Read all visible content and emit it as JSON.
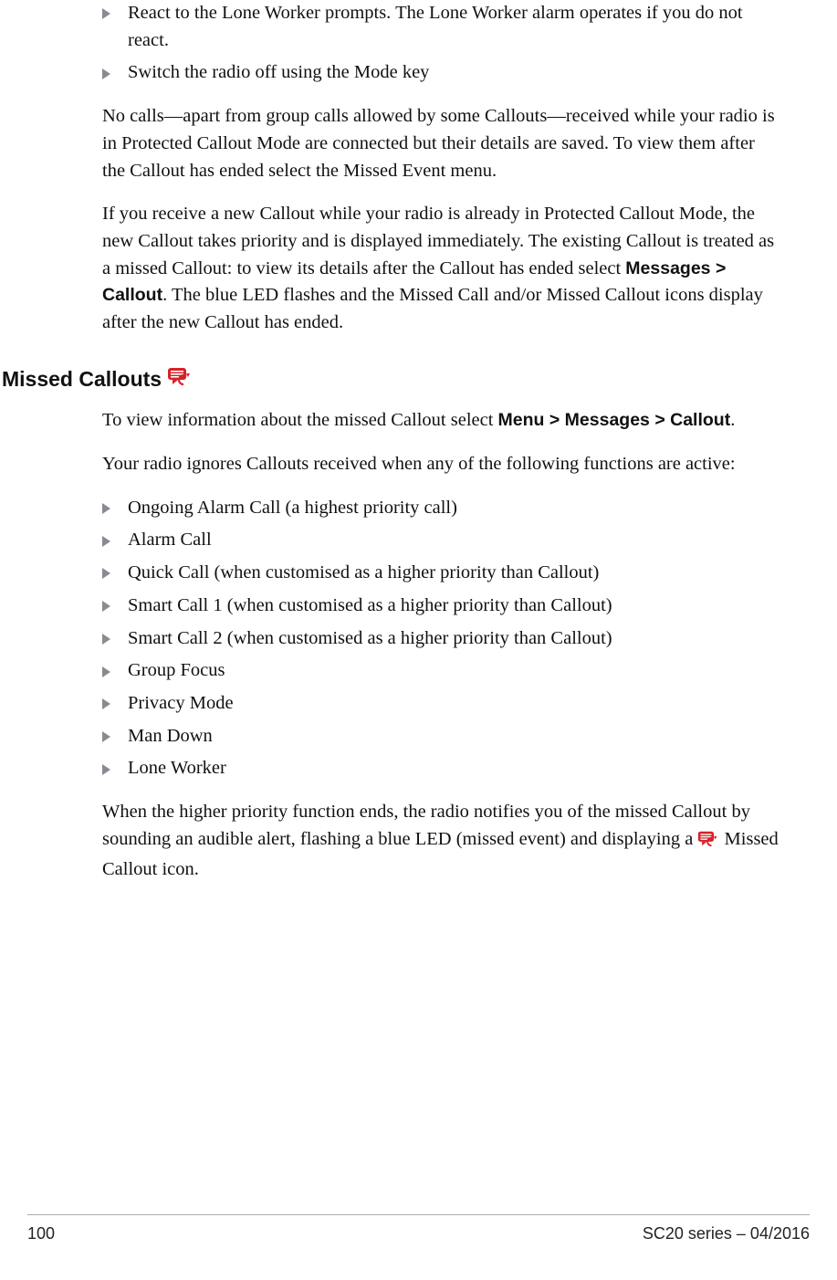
{
  "top_list": [
    "React to the Lone Worker prompts. The Lone Worker alarm operates if you do not react.",
    "Switch the radio off using the Mode key"
  ],
  "para1": "No calls—apart from group calls allowed by some Callouts—received while your radio is in Protected Callout Mode are connected but their details are saved. To view them after the Callout has ended select the Missed Event menu.",
  "para2_pre": "If you receive a new Callout while your radio is already in Protected Callout Mode, the new Callout takes priority and is displayed immediately. The existing Callout is treated as a missed Callout: to view its details after the Callout has ended select ",
  "para2_bold": "Messages > Callout",
  "para2_post": ". The blue LED flashes and the Missed Call and/or Missed Callout icons display after the new Callout has ended.",
  "heading": "Missed Callouts",
  "mc_para1_pre": "To view information about the missed Callout select ",
  "mc_para1_bold": "Menu > Messages > Callout",
  "mc_para1_post": ".",
  "mc_para2": "Your radio ignores Callouts received when any of the following functions are active:",
  "mc_list": [
    "Ongoing Alarm Call (a highest priority call)",
    "Alarm Call",
    "Quick Call (when customised as a higher priority than Callout)",
    "Smart Call 1 (when customised as a higher priority than Callout)",
    "Smart Call 2 (when customised as a higher priority than Callout)",
    "Group Focus",
    "Privacy Mode",
    "Man Down",
    "Lone Worker"
  ],
  "mc_para3_pre": "When the higher priority function ends, the radio notifies you of the missed Callout by sounding an audible alert, flashing a blue LED (missed event) and displaying a ",
  "mc_para3_post": " Missed Callout icon.",
  "footer": {
    "page": "100",
    "doc": "SC20 series – 04/2016"
  }
}
